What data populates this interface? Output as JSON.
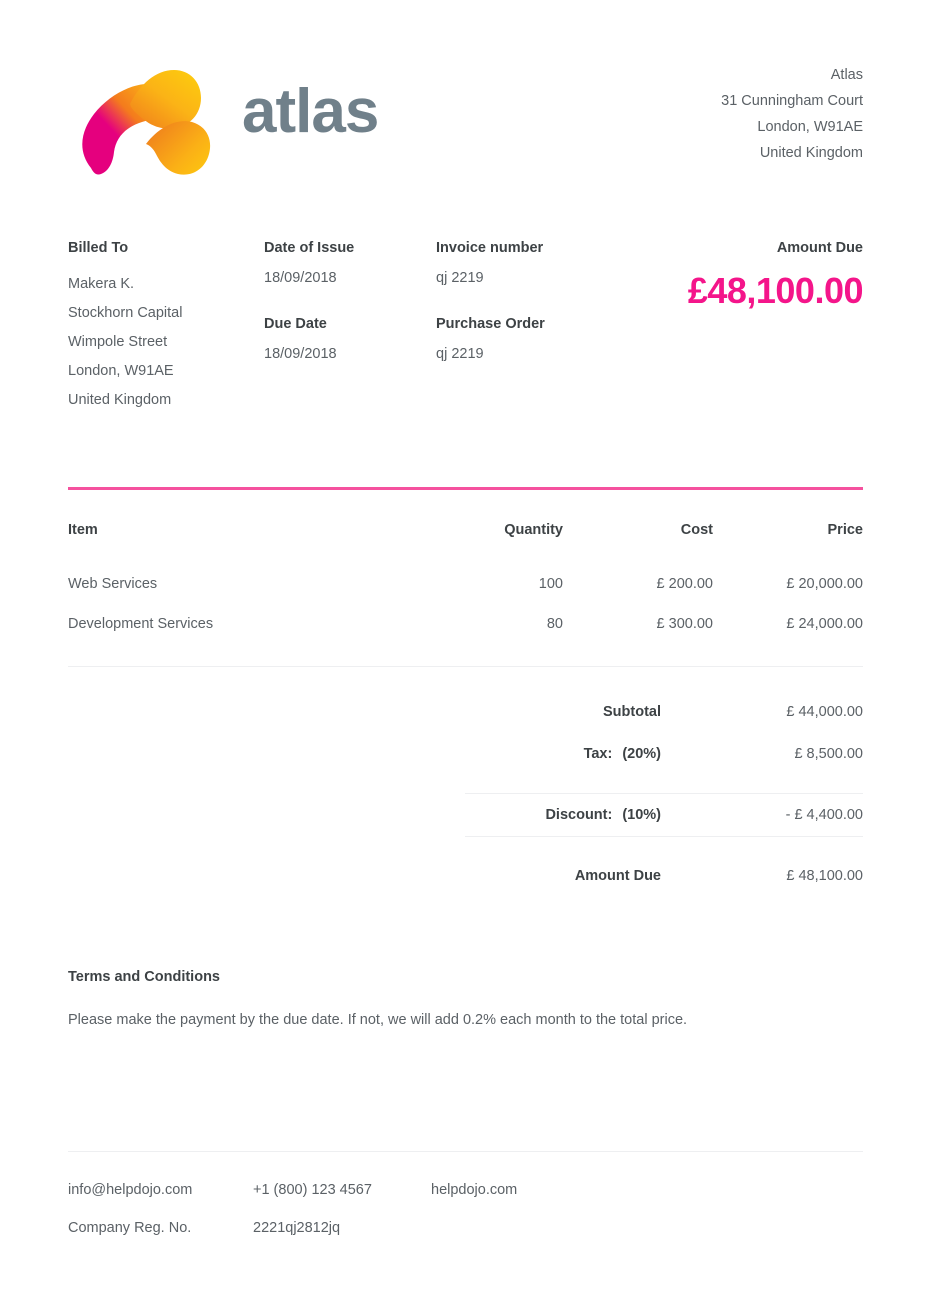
{
  "brand": {
    "wordmark": "atlas",
    "logo_icon": "atlas-swirl-logo",
    "colors": {
      "magenta": "#e5007e",
      "orange": "#f79a1e",
      "yellow": "#fdc513",
      "wordmark_gray": "#70808a",
      "accent_pink": "#f5519e",
      "amount_pink": "#f4158a"
    }
  },
  "company_address": {
    "name": "Atlas",
    "street": "31 Cunningham Court",
    "city": "London, W91AE",
    "country": "United Kingdom"
  },
  "billed_to": {
    "label": "Billed To",
    "name": "Makera K.",
    "company": "Stockhorn Capital",
    "street": "Wimpole Street",
    "city": "London, W91AE",
    "country": "United Kingdom"
  },
  "dates": {
    "issue_label": "Date of Issue",
    "issue_value": "18/09/2018",
    "due_label": "Due Date",
    "due_value": "18/09/2018"
  },
  "invoice": {
    "number_label": "Invoice number",
    "number_value": "qj 2219",
    "po_label": "Purchase Order",
    "po_value": "qj 2219"
  },
  "amount_due": {
    "label": "Amount Due",
    "value": "£48,100.00"
  },
  "table": {
    "headers": {
      "item": "Item",
      "quantity": "Quantity",
      "cost": "Cost",
      "price": "Price"
    },
    "rows": [
      {
        "item": "Web Services",
        "quantity": "100",
        "cost": "£ 200.00",
        "price": "£ 20,000.00"
      },
      {
        "item": "Development Services",
        "quantity": "80",
        "cost": "£ 300.00",
        "price": "£ 24,000.00"
      }
    ]
  },
  "totals": {
    "subtotal_label": "Subtotal",
    "subtotal_value": "£ 44,000.00",
    "tax_label": "Tax:",
    "tax_percent": "(20%)",
    "tax_value": "£ 8,500.00",
    "discount_label": "Discount:",
    "discount_percent": "(10%)",
    "discount_value": "- £ 4,400.00",
    "amount_due_label": "Amount Due",
    "amount_due_value": "£ 48,100.00"
  },
  "terms": {
    "title": "Terms and Conditions",
    "body": "Please make the payment by the due date. If not, we will add 0.2% each month to the total price."
  },
  "footer": {
    "email": "info@helpdojo.com",
    "phone": "+1 (800) 123 4567",
    "website": "helpdojo.com",
    "reg_label": "Company Reg. No.",
    "reg_value": "2221qj2812jq"
  }
}
